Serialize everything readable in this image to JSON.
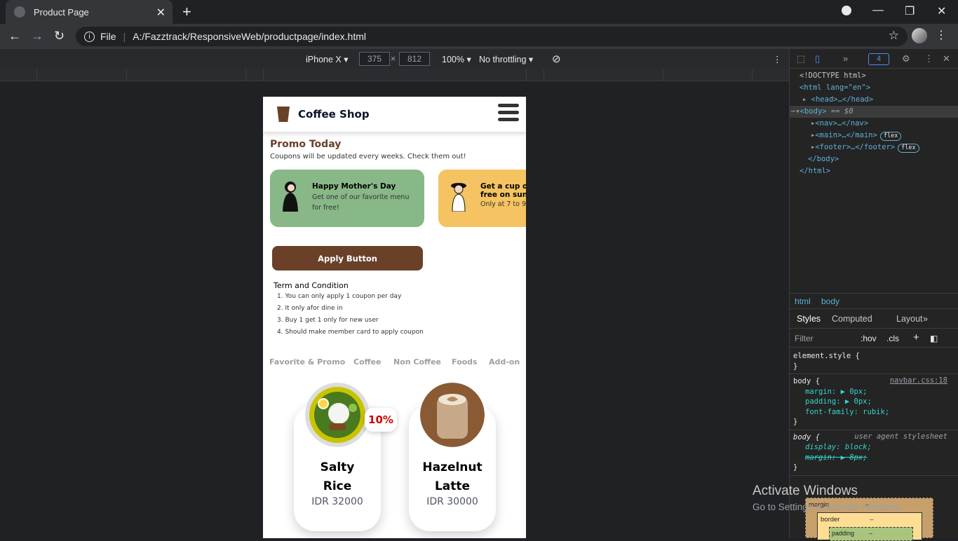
{
  "browser": {
    "tab_title": "Product Page",
    "url_scheme": "File",
    "url_path": "A:/Fazztrack/ResponsiveWeb/productpage/index.html"
  },
  "device_toolbar": {
    "device": "iPhone X",
    "width": "375",
    "height": "812",
    "zoom": "100%",
    "throttle": "No throttling"
  },
  "site": {
    "brand": "Coffee Shop",
    "promo_title": "Promo Today",
    "promo_subtitle": "Coupons will be updated every weeks. Check them out!",
    "cards": [
      {
        "title": "Happy Mother's Day",
        "desc1": "Get one of our favorite menu",
        "desc2": "for free!",
        "color": "#88b788"
      },
      {
        "title": "Get a cup o",
        "title2": "free on sun",
        "desc1": "Only at 7 to 9",
        "color": "#f5c361"
      }
    ],
    "apply_label": "Apply Button",
    "term_title": "Term and Condition",
    "terms": [
      "1. You can only apply 1 coupon per day",
      "2. It only afor dine in",
      "3. Buy 1 get 1 only for new user",
      "4. Should make member card to apply coupon"
    ],
    "categories": [
      "Favorite & Promo",
      "Coffee",
      "Non Coffee",
      "Foods",
      "Add-on"
    ],
    "products": [
      {
        "name1": "Salty",
        "name2": "Rice",
        "price": "IDR 32000",
        "discount": "10%"
      },
      {
        "name1": "Hazelnut",
        "name2": "Latte",
        "price": "IDR 30000"
      }
    ]
  },
  "devtools": {
    "badge": "4",
    "dom": [
      "<!DOCTYPE html>",
      "<html lang=\"en\">",
      "<head>…</head>",
      "<body>",
      "== $0",
      "<nav>…</nav>",
      "<main>…</main>",
      "<footer>…</footer>",
      "</body>",
      "</html>"
    ],
    "flex": "flex",
    "crumbs": [
      "html",
      "body"
    ],
    "tabs": [
      "Styles",
      "Computed",
      "Layout"
    ],
    "filter": "Filter",
    "hov": ":hov",
    "cls": ".cls",
    "css_lines": {
      "element_style": "element.style {",
      "close": "}",
      "body_sel": "body {",
      "src": "navbar.css:18",
      "margin": "margin: ▶ 0px;",
      "padding": "padding: ▶ 0px;",
      "font": "font-family: rubik;",
      "ua": "user agent stylesheet",
      "display": "display: block;",
      "margin_ua": "margin: ▶ 8px;"
    },
    "box_margin": "margin",
    "box_border": "border",
    "box_padding": "padding",
    "dash": "–"
  },
  "watermark": {
    "line1": "Activate Windows",
    "line2": "Go to Settings to activate Windows."
  }
}
